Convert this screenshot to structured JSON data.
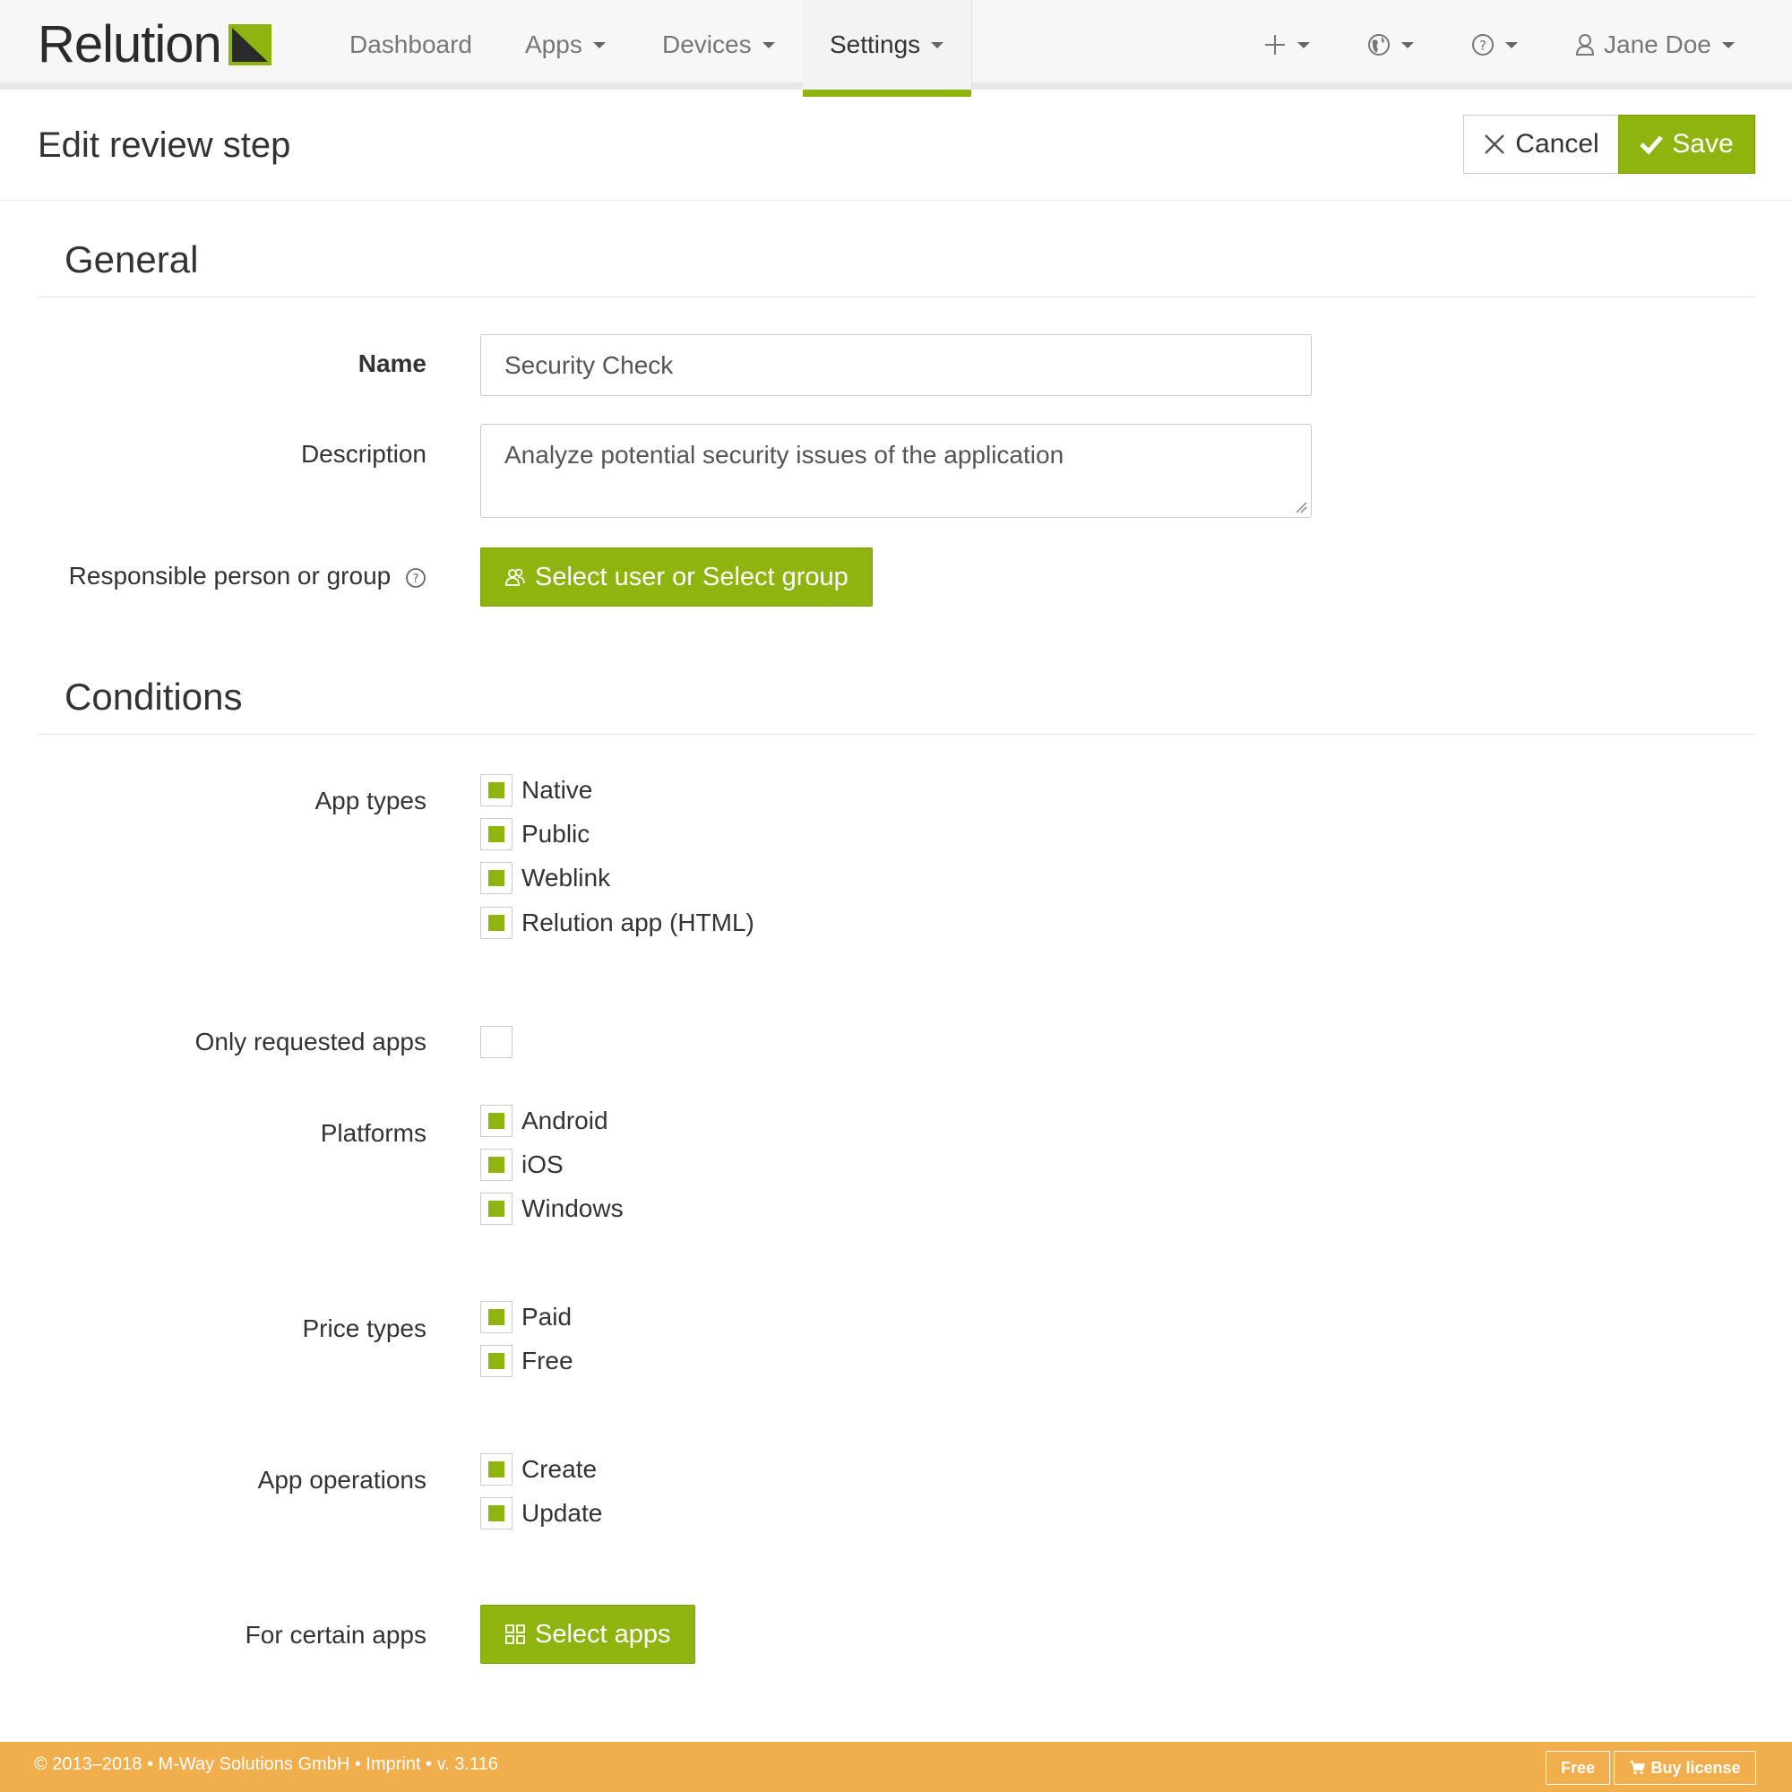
{
  "brand": {
    "name": "Relution",
    "accent": "#8fb30f",
    "footer_color": "#f0ae4d"
  },
  "nav": {
    "dashboard": "Dashboard",
    "apps": "Apps",
    "devices": "Devices",
    "settings": "Settings",
    "user": "Jane Doe",
    "icons": [
      "plus-icon",
      "globe-icon",
      "help-circle-icon",
      "user-icon"
    ]
  },
  "header": {
    "title": "Edit review step",
    "cancel": "Cancel",
    "save": "Save"
  },
  "general": {
    "title": "General",
    "name_label": "Name",
    "name_value": "Security Check",
    "description_label": "Description",
    "description_value": "Analyze potential security issues of the application",
    "responsible_label": "Responsible person or group",
    "responsible_button": "Select user or Select group"
  },
  "conditions": {
    "title": "Conditions",
    "app_types": {
      "label": "App types",
      "options": [
        {
          "label": "Native",
          "checked": true
        },
        {
          "label": "Public",
          "checked": true
        },
        {
          "label": "Weblink",
          "checked": true
        },
        {
          "label": "Relution app (HTML)",
          "checked": true
        }
      ]
    },
    "only_requested": {
      "label": "Only requested apps",
      "checked": false
    },
    "platforms": {
      "label": "Platforms",
      "options": [
        {
          "label": "Android",
          "checked": true
        },
        {
          "label": "iOS",
          "checked": true
        },
        {
          "label": "Windows",
          "checked": true
        }
      ]
    },
    "price_types": {
      "label": "Price types",
      "options": [
        {
          "label": "Paid",
          "checked": true
        },
        {
          "label": "Free",
          "checked": true
        }
      ]
    },
    "app_operations": {
      "label": "App operations",
      "options": [
        {
          "label": "Create",
          "checked": true
        },
        {
          "label": "Update",
          "checked": true
        }
      ]
    },
    "certain_apps": {
      "label": "For certain apps",
      "button": "Select apps"
    }
  },
  "footer": {
    "text": "© 2013–2018 • M-Way Solutions GmbH • Imprint • v. 3.116",
    "free": "Free",
    "buy": "Buy license"
  }
}
